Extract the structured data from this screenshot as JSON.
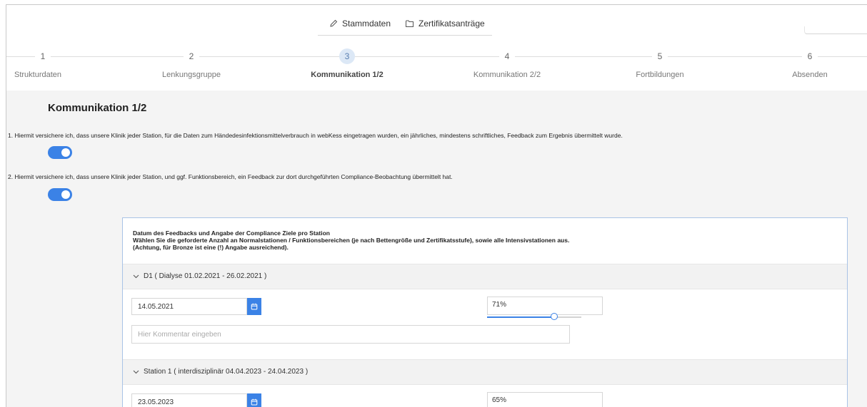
{
  "topnav": {
    "tabs": [
      {
        "label": "Stammdaten",
        "icon": "pencil-icon"
      },
      {
        "label": "Zertifikatsanträge",
        "icon": "folder-icon"
      }
    ]
  },
  "stepper": {
    "steps": [
      {
        "number": "1",
        "label": "Strukturdaten"
      },
      {
        "number": "2",
        "label": "Lenkungsgruppe"
      },
      {
        "number": "3",
        "label": "Kommunikation 1/2"
      },
      {
        "number": "4",
        "label": "Kommunikation 2/2"
      },
      {
        "number": "5",
        "label": "Fortbildungen"
      },
      {
        "number": "6",
        "label": "Absenden"
      }
    ],
    "active_index": 2
  },
  "page": {
    "title": "Kommunikation 1/2",
    "questions": [
      {
        "text": "1. Hiermit versichere ich, dass unsere Klinik jeder Station, für die Daten zum Händedesinfektionsmittelverbrauch in webKess eingetragen wurden, ein jährliches, mindestens schriftliches, Feedback zum Ergebnis übermittelt wurde.",
        "toggle_on": true
      },
      {
        "text": "2. Hiermit versichere ich, dass unsere Klinik jeder Station, und ggf. Funktionsbereich, ein Feedback zur dort durchgeführten Compliance-Beobachtung übermittelt hat.",
        "toggle_on": true
      }
    ]
  },
  "panel": {
    "heading_lines": [
      "Datum des Feedbacks und Angabe der Compliance Ziele pro Station",
      "Wählen Sie die geforderte Anzahl an Normalstationen / Funktionsbereichen (je nach Bettengröße und Zertifikatsstufe), sowie alle Intensivstationen aus.",
      "(Achtung, für Bronze ist eine (!) Angabe ausreichend)."
    ],
    "sections": [
      {
        "title": "D1 ( Dialyse 01.02.2021 - 26.02.2021 )",
        "date": "14.05.2021",
        "percent_label": "71%",
        "percent_value": 71,
        "comment_placeholder": "Hier Kommentar eingeben"
      },
      {
        "title": "Station 1 ( interdisziplinär 04.04.2023 - 24.04.2023 )",
        "date": "23.05.2023",
        "percent_label": "65%",
        "percent_value": 65
      }
    ]
  },
  "colors": {
    "accent": "#3b82e6",
    "panel_border": "#a9c3e6",
    "content_bg": "#f4f4f4",
    "active_step_bg": "#dce8f6"
  }
}
